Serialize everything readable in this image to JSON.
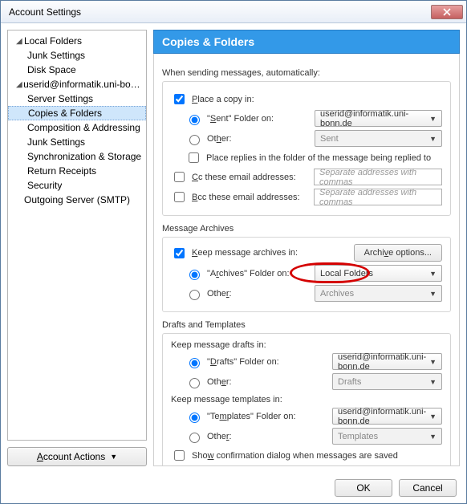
{
  "window": {
    "title": "Account Settings"
  },
  "sidebar": {
    "local_folders": "Local Folders",
    "junk_settings": "Junk Settings",
    "disk_space": "Disk Space",
    "account": "userid@informatik.uni-bonn.de",
    "server_settings": "Server Settings",
    "copies_folders": "Copies & Folders",
    "composition": "Composition & Addressing",
    "junk_settings2": "Junk Settings",
    "sync_storage": "Synchronization & Storage",
    "return_receipts": "Return Receipts",
    "security": "Security",
    "outgoing": "Outgoing Server (SMTP)",
    "account_actions": "Account Actions"
  },
  "panel": {
    "title": "Copies & Folders",
    "sending_label": "When sending messages, automatically:",
    "place_copy": "Place a copy in:",
    "sent_folder_on": "\"Sent\" Folder on:",
    "other": "Other:",
    "sent_account": "userid@informatik.uni-bonn.de",
    "sent_other": "Sent",
    "place_replies": "Place replies in the folder of the message being replied to",
    "cc_label": "Cc these email addresses:",
    "bcc_label": "Bcc these email addresses:",
    "addr_placeholder": "Separate addresses with commas",
    "archives_title": "Message Archives",
    "keep_archives": "Keep message archives in:",
    "archive_options": "Archive options...",
    "archives_folder_on": "\"Archives\" Folder on:",
    "archives_account": "Local Folders",
    "archives_other": "Archives",
    "drafts_templates": "Drafts and Templates",
    "keep_drafts": "Keep message drafts in:",
    "drafts_folder_on": "\"Drafts\" Folder on:",
    "drafts_account": "userid@informatik.uni-bonn.de",
    "drafts_other": "Drafts",
    "keep_templates": "Keep message templates in:",
    "templates_folder_on": "\"Templates\" Folder on:",
    "templates_account": "userid@informatik.uni-bonn.de",
    "templates_other": "Templates",
    "show_confirm": "Show confirmation dialog when messages are saved"
  },
  "footer": {
    "ok": "OK",
    "cancel": "Cancel"
  }
}
